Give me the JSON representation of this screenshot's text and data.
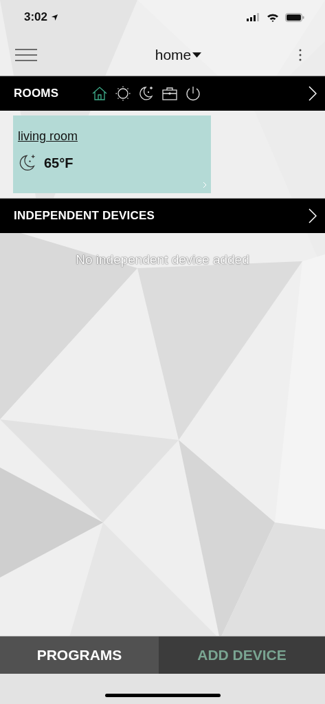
{
  "status_bar": {
    "time": "3:02"
  },
  "nav": {
    "title": "home"
  },
  "rooms_header": {
    "title": "ROOMS",
    "modes": [
      {
        "kind": "home",
        "selected": true
      },
      {
        "kind": "day",
        "selected": false
      },
      {
        "kind": "night",
        "selected": false
      },
      {
        "kind": "away",
        "selected": false
      },
      {
        "kind": "off",
        "selected": false
      }
    ]
  },
  "rooms": [
    {
      "name": "living room",
      "kind": "night",
      "temperature": "65°F"
    }
  ],
  "devices_header": {
    "title": "INDEPENDENT DEVICES"
  },
  "empty_message": "No independent device added",
  "bottom_bar": [
    {
      "label": "PROGRAMS",
      "selected": false
    },
    {
      "label": "ADD DEVICE",
      "selected": true
    }
  ]
}
